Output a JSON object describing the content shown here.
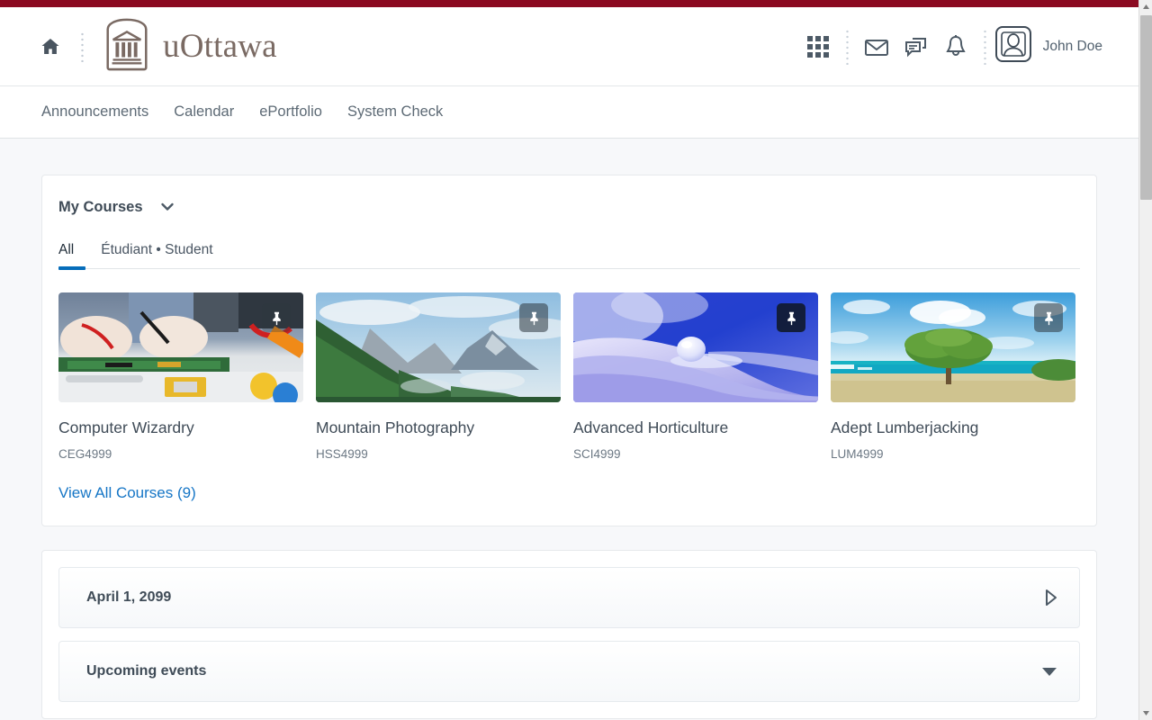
{
  "theme": {
    "banner_color": "#8b0920",
    "logo_color": "#7a6a63",
    "accent_blue": "#066dba",
    "link_blue": "#1676c6",
    "page_bg": "#f7f8fa"
  },
  "header": {
    "home_icon": "home-icon",
    "logo_icon": "uottawa-crest-icon",
    "logo_text": "uOttawa",
    "icons": [
      {
        "name": "waffle-grid-icon",
        "label": "Course Selector"
      },
      {
        "name": "envelope-icon",
        "label": "Email"
      },
      {
        "name": "chat-bubbles-icon",
        "label": "Messages"
      },
      {
        "name": "bell-icon",
        "label": "Notifications"
      }
    ],
    "user": {
      "avatar_icon": "user-avatar-icon",
      "name": "John Doe"
    }
  },
  "navbar": {
    "items": [
      {
        "label": "Announcements"
      },
      {
        "label": "Calendar"
      },
      {
        "label": "ePortfolio"
      },
      {
        "label": "System Check"
      }
    ]
  },
  "my_courses": {
    "title": "My Courses",
    "collapse_icon": "chevron-down-icon",
    "tabs": [
      {
        "label": "All",
        "active": true
      },
      {
        "label": "Étudiant • Student",
        "active": false
      }
    ],
    "courses": [
      {
        "name": "Computer Wizardry",
        "code": "CEG4999",
        "image": "electronics-repair-photo",
        "pin_icon": "pin-icon",
        "pin_style": "faint"
      },
      {
        "name": "Mountain Photography",
        "code": "HSS4999",
        "image": "mountain-forest-photo",
        "pin_icon": "pin-icon",
        "pin_style": "light"
      },
      {
        "name": "Advanced Horticulture",
        "code": "SCI4999",
        "image": "water-droplet-petal-photo",
        "pin_icon": "pin-icon",
        "pin_style": "dark"
      },
      {
        "name": "Adept Lumberjacking",
        "code": "LUM4999",
        "image": "beach-tree-photo",
        "pin_icon": "pin-icon",
        "pin_style": "light"
      }
    ],
    "view_all_label": "View All Courses (9)"
  },
  "calendar_panel": {
    "rows": [
      {
        "label": "April 1, 2099",
        "icon": "triangle-right-icon"
      },
      {
        "label": "Upcoming events",
        "icon": "triangle-down-icon"
      }
    ]
  },
  "scrollbar": {
    "up_icon": "scroll-up-arrow-icon",
    "down_icon": "scroll-down-arrow-icon",
    "thumb": "scrollbar-thumb"
  }
}
